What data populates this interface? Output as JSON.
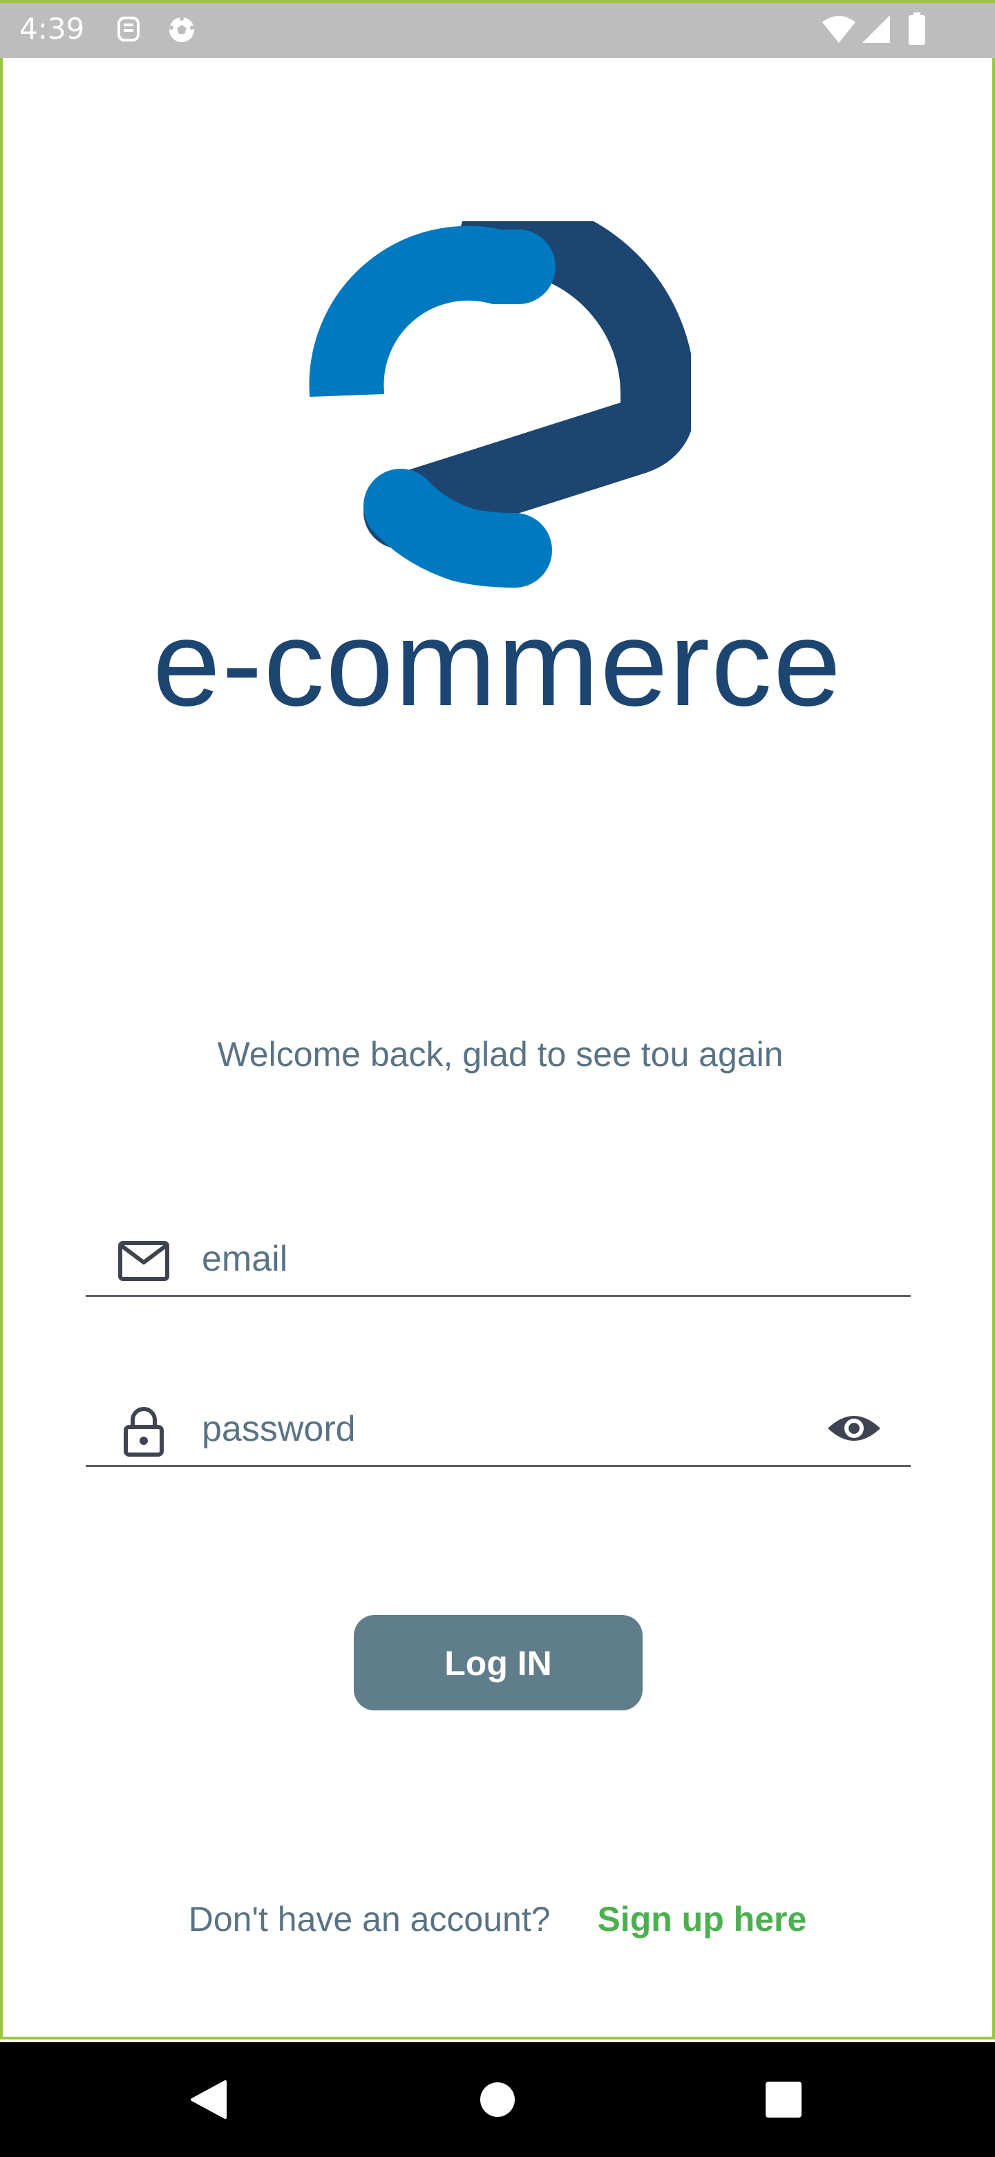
{
  "status_bar": {
    "time": "4:39",
    "left_icons": [
      "sim-card-icon",
      "soccer-ball-icon"
    ],
    "right_icons": [
      "wifi-icon",
      "cellular-signal-icon",
      "battery-icon"
    ]
  },
  "logo": {
    "icon": "e-logo-icon",
    "wordmark": "e-commerce",
    "colors": {
      "light_blue": "#0079c1",
      "dark_blue": "#1d4572"
    }
  },
  "welcome_text": "Welcome back, glad to see tou again",
  "form": {
    "email": {
      "icon": "mail-icon",
      "placeholder": "email",
      "value": ""
    },
    "password": {
      "icon": "lock-icon",
      "placeholder": "password",
      "value": "",
      "toggle_icon": "eye-icon"
    },
    "login_label": "Log IN"
  },
  "signup": {
    "prompt": "Don't have an account?",
    "link_label": "Sign up here"
  },
  "navigation": {
    "buttons": [
      "back-icon",
      "home-icon",
      "recents-icon"
    ]
  },
  "colors": {
    "primary_button": "#607d8b",
    "link": "#4caf50",
    "muted_text": "#5a7384",
    "status_bar": "#bdbdbd",
    "nav_bar": "#000000",
    "frame_accent": "#9bc53d"
  }
}
